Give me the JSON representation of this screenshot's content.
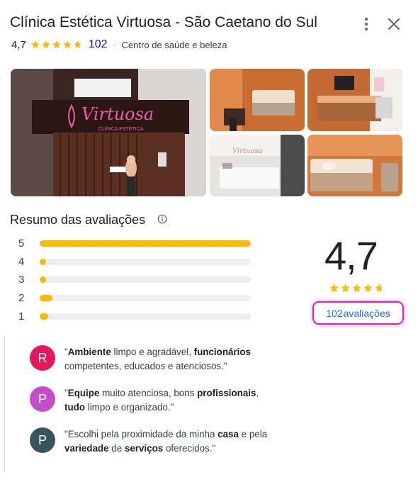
{
  "header": {
    "title": "Clínica Estética Virtuosa - São Caetano do Sul",
    "rating": "4,7",
    "review_count": "102",
    "separator": "·",
    "category": "Centro de saúde e beleza",
    "stars_value": 4.7
  },
  "photos": {
    "sign_main": "Virtuosa",
    "sign_sub": "CLÍNICA ESTÉTICA",
    "reception_sign": "Virtuosa"
  },
  "summary": {
    "title": "Resumo das avaliações",
    "bars": [
      {
        "label": "5",
        "fraction": 1.0
      },
      {
        "label": "4",
        "fraction": 0.03
      },
      {
        "label": "3",
        "fraction": 0.02
      },
      {
        "label": "2",
        "fraction": 0.06
      },
      {
        "label": "1",
        "fraction": 0.04
      }
    ],
    "overall": "4,7",
    "reviews_count": "102",
    "reviews_label": "avaliações"
  },
  "snippets": [
    {
      "avatar_letter": "R",
      "avatar_color": "#e8175d",
      "parts": [
        [
          "\"",
          false
        ],
        [
          "Ambiente",
          true
        ],
        [
          " limpo e agradável, ",
          false
        ],
        [
          "funcionários",
          true
        ],
        [
          " competentes, educados e atenciosos.\"",
          false
        ]
      ]
    },
    {
      "avatar_letter": "P",
      "avatar_color": "#c44dc8",
      "parts": [
        [
          "\"",
          false
        ],
        [
          "Equipe",
          true
        ],
        [
          " muito atenciosa, bons ",
          false
        ],
        [
          "profissionais",
          true
        ],
        [
          ", ",
          false
        ],
        [
          "tudo",
          true
        ],
        [
          " limpo e organizado.\"",
          false
        ]
      ]
    },
    {
      "avatar_letter": "P",
      "avatar_color": "#37545f",
      "parts": [
        [
          "\"Escolhi pela proximidade da minha ",
          false
        ],
        [
          "casa",
          true
        ],
        [
          " e pela ",
          false
        ],
        [
          "variedade",
          true
        ],
        [
          " de ",
          false
        ],
        [
          "serviços",
          true
        ],
        [
          " oferecidos.\"",
          false
        ]
      ]
    }
  ],
  "colors": {
    "star": "#f9ba00",
    "star_empty": "#dadce0",
    "accent_link": "#1a0dab",
    "highlight_border": "#f01fa5"
  },
  "icons": [
    "more-vert-icon",
    "close-icon",
    "star-icon",
    "info-icon"
  ]
}
